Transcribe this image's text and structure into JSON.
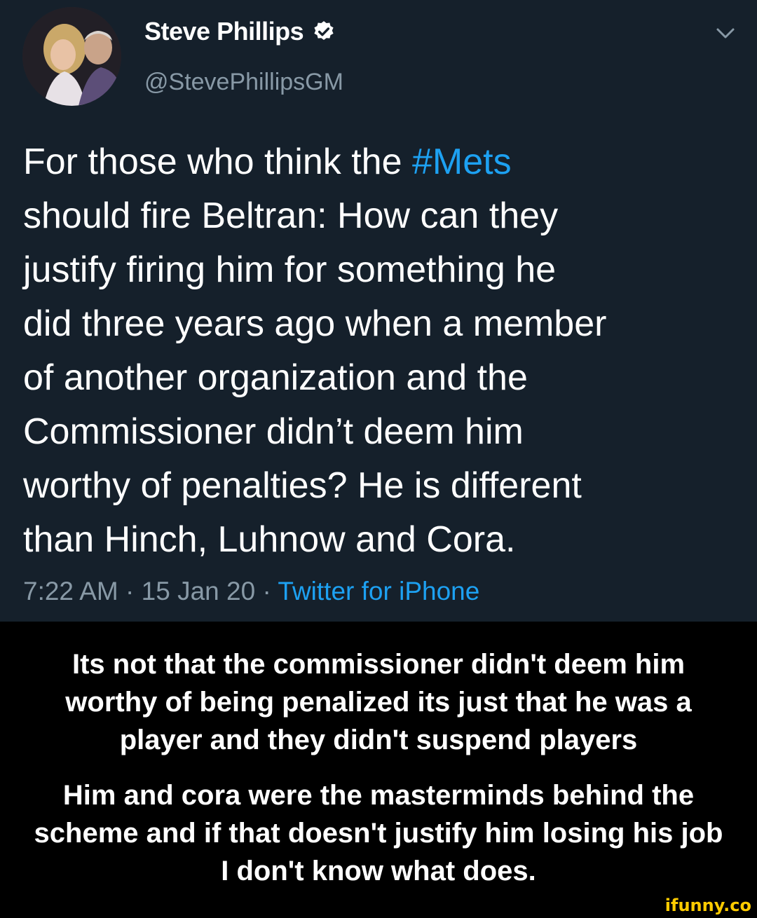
{
  "tweet": {
    "author_name": "Steve Phillips",
    "author_handle": "@StevePhillipsGM",
    "text_lines": [
      [
        "For those who think the ",
        "#Mets"
      ],
      [
        "should fire Beltran:  How can they"
      ],
      [
        "justify firing him for something he"
      ],
      [
        "did three years ago when a member"
      ],
      [
        "of another organization and the"
      ],
      [
        "Commissioner didn’t deem him"
      ],
      [
        "worthy of penalties?  He is different"
      ],
      [
        "than Hinch, Luhnow and Cora."
      ]
    ],
    "time": "7:22 AM",
    "date": "15 Jan 20",
    "separator": " · ",
    "source": "Twitter for iPhone",
    "icons": [
      "verified-badge-icon",
      "chevron-down-icon"
    ],
    "colors": {
      "background": "#15202b",
      "link": "#1da1f2",
      "secondary": "#8899a6"
    }
  },
  "caption": {
    "paragraph1": [
      "Its not that the commissioner didn't deem him",
      "worthy of being penalized its just that he was a",
      "player and they didn't suspend players"
    ],
    "paragraph2": [
      "Him and cora were the masterminds behind the",
      "scheme and if that doesn't justify him losing his job",
      "I don't know what does."
    ]
  },
  "watermark": "ifunny.co"
}
